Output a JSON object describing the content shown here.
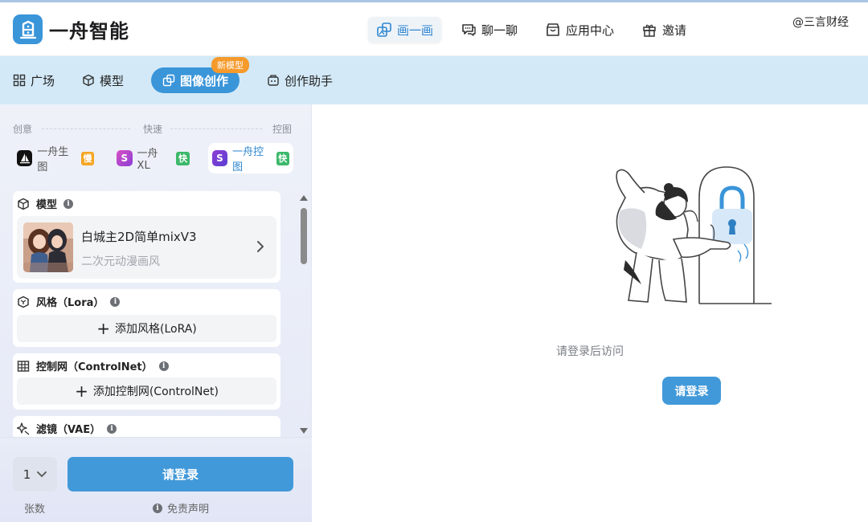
{
  "app": {
    "name": "一舟智能",
    "watermark": "@三言财经"
  },
  "topnav": [
    {
      "label": "画一画",
      "icon": "draw-icon",
      "active": true
    },
    {
      "label": "聊一聊",
      "icon": "chat-icon",
      "active": false
    },
    {
      "label": "应用中心",
      "icon": "store-icon",
      "active": false
    },
    {
      "label": "邀请",
      "icon": "gift-icon",
      "active": false
    }
  ],
  "subnav": [
    {
      "label": "广场",
      "icon": "grid-icon"
    },
    {
      "label": "模型",
      "icon": "cube-icon"
    },
    {
      "label": "图像创作",
      "icon": "image-create-icon",
      "active": true,
      "badge": "新模型"
    },
    {
      "label": "创作助手",
      "icon": "assistant-icon"
    }
  ],
  "modes": {
    "headers": [
      "创意",
      "快速",
      "控图"
    ],
    "items": [
      {
        "label": "一舟生图",
        "tag": "慢",
        "tag_color": "#f5a623",
        "icon_color": "#111111"
      },
      {
        "label": "一舟 XL",
        "tag": "快",
        "tag_color": "#3cb86a",
        "icon_color": "#c447c9"
      },
      {
        "label": "一舟控图",
        "tag": "快",
        "tag_color": "#3cb86a",
        "icon_color": "#6c3fd1",
        "active": true
      }
    ]
  },
  "model_card": {
    "title": "模型",
    "model_name": "白城主2D简单mixV3",
    "model_desc": "二次元动漫画风"
  },
  "style_card": {
    "title": "风格（Lora）",
    "add_label": "添加风格(LoRA)"
  },
  "controlnet_card": {
    "title": "控制网（ControlNet）",
    "add_label": "添加控制网(ControlNet)"
  },
  "vae_card": {
    "title": "滤镜（VAE）"
  },
  "bottom": {
    "quantity": "1",
    "quantity_label": "张数",
    "login_label": "请登录",
    "disclaimer": "免责声明"
  },
  "main": {
    "message": "请登录后访问",
    "login_label": "请登录"
  },
  "colors": {
    "accent": "#3a95d9",
    "subbar_bg": "#d3e9f7",
    "badge": "#f59a2b"
  }
}
